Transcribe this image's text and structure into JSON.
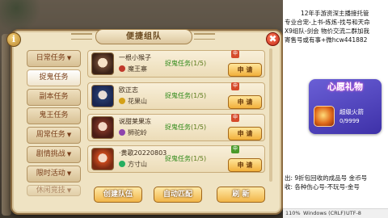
{
  "dialog": {
    "title": "便捷组队",
    "info_glyph": "i",
    "close_glyph": "✖"
  },
  "tabs": [
    {
      "label": "日常任务",
      "arrow": "▼"
    },
    {
      "label": "捉鬼任务",
      "arrow": ""
    },
    {
      "label": "副本任务",
      "arrow": ""
    },
    {
      "label": "鬼王任务",
      "arrow": ""
    },
    {
      "label": "周常任务",
      "arrow": "▼"
    },
    {
      "label": "剧情挑战",
      "arrow": "▼"
    },
    {
      "label": "限时活动",
      "arrow": "▼"
    },
    {
      "label": "休闲竞技",
      "arrow": "▼"
    }
  ],
  "rows": [
    {
      "name": "一根小猴子",
      "school": "魔王寨",
      "task": "捉鬼任务",
      "count": "(1/5)",
      "join": "申 请",
      "tag": "申"
    },
    {
      "name": "欧正志",
      "school": "花果山",
      "task": "捉鬼任务",
      "count": "(1/5)",
      "join": "申 请",
      "tag": "申"
    },
    {
      "name": "说甜莱果冻",
      "school": "狮驼岭",
      "task": "捉鬼任务",
      "count": "(1/5)",
      "join": "申 请",
      "tag": "申"
    },
    {
      "name": "·黄歌20220803",
      "school": "方寸山",
      "task": "捉鬼任务",
      "count": "(1/5)",
      "join": "申 请",
      "tag": "申"
    }
  ],
  "buttons": {
    "create": "创建队伍",
    "auto": "自动匹配",
    "refresh": "刷 新"
  },
  "side": {
    "lines": [
      "12年手游资深主播接托管",
      "专业合宠-上书-炼炼-找号和天命",
      "X9组队-剑会 物价交流二群加我",
      "寄售号或有事+微hcw441882"
    ],
    "wish_title": "心愿礼物",
    "wish_item_name": "超级火箭",
    "wish_count": "0/9999",
    "footer_lines": [
      "出: 9折包回收的成品号  金币号",
      "收: 各种伤心号-不玩号-金号"
    ]
  },
  "status_bar": {
    "zoom": "110%",
    "line_ending": "Windows (CRLF)",
    "encoding": "UTF-8"
  }
}
